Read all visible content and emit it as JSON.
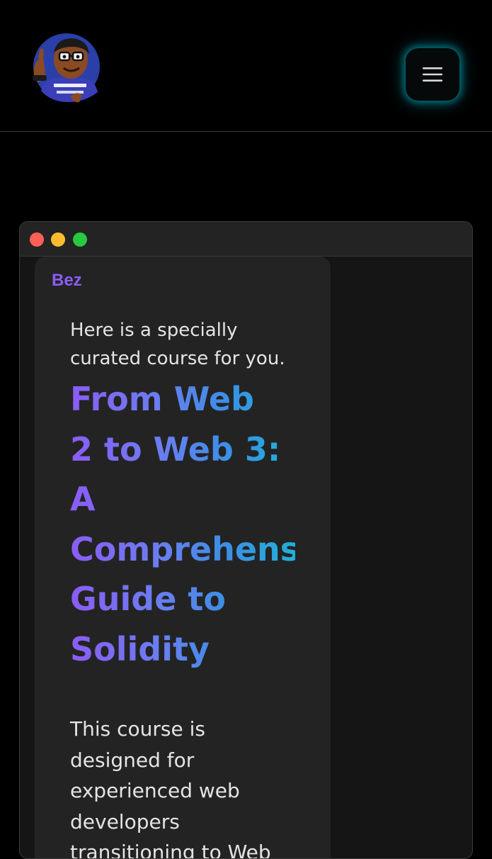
{
  "header": {
    "avatar_icon": "cartoon-avatar-icon",
    "menu_icon": "hamburger-menu-icon"
  },
  "window": {
    "controls": [
      "close",
      "minimize",
      "maximize"
    ],
    "colors": {
      "close": "#fe5f57",
      "minimize": "#febc2e",
      "maximize": "#28c840"
    }
  },
  "message": {
    "sender": "Bez",
    "intro_lines": [
      "Here is a specially",
      "curated course for you."
    ],
    "course_title_lines": [
      "From Web",
      "2 to Web 3:",
      "A",
      "Comprehensive",
      "Guide to",
      "Solidity"
    ],
    "description_lines": [
      "This course is",
      "designed for",
      "experienced web",
      "developers",
      "transitioning to Web"
    ]
  },
  "colors": {
    "background": "#000000",
    "accent_purple": "#8b5cf6",
    "accent_cyan": "#1fb2d8",
    "glow": "#00b4c8"
  }
}
